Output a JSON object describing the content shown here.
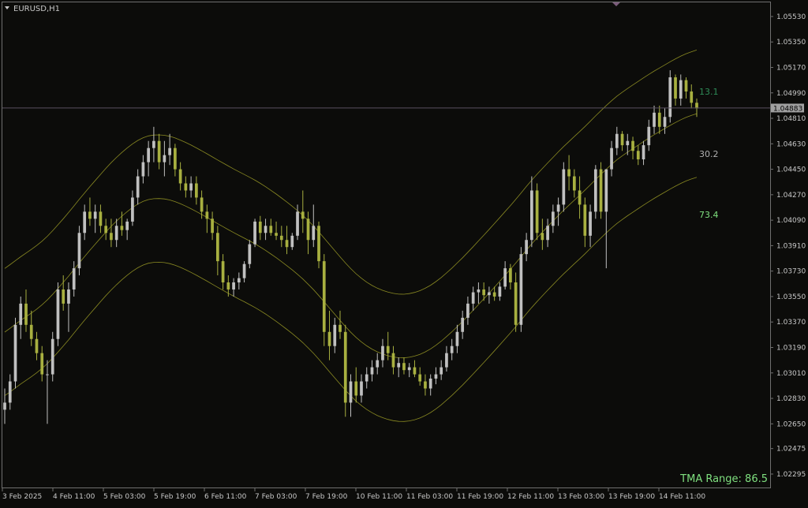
{
  "header": {
    "symbol_label": "EURUSD,H1"
  },
  "colors": {
    "background": "#0c0c0a",
    "axis": "#6f6f6f",
    "text": "#c8c8c8",
    "bull": "#c0c0c0",
    "bear": "#a8b040",
    "band": "#8a8a22",
    "price_line": "#5a5060",
    "price_badge_bg": "#a0a0a0",
    "tma_range_text": "#7fe07f",
    "label_top": "#2e8b57",
    "label_mid": "#b0b0b0",
    "label_bottom": "#7fe07f"
  },
  "chart_data": {
    "type": "candlestick",
    "symbol": "EURUSD",
    "timeframe": "H1",
    "ylim": [
      1.022,
      1.0563
    ],
    "y_ticks": [
      "1.05530",
      "1.05350",
      "1.05170",
      "1.04990",
      "1.04810",
      "1.04630",
      "1.04450",
      "1.04270",
      "1.04090",
      "1.03910",
      "1.03730",
      "1.03550",
      "1.03370",
      "1.03190",
      "1.03010",
      "1.02830",
      "1.02650",
      "1.02475",
      "1.02295"
    ],
    "x_ticks": [
      "3 Feb 2025",
      "4 Feb 11:00",
      "5 Feb 03:00",
      "5 Feb 19:00",
      "6 Feb 11:00",
      "7 Feb 03:00",
      "7 Feb 19:00",
      "10 Feb 11:00",
      "11 Feb 03:00",
      "11 Feb 19:00",
      "12 Feb 11:00",
      "13 Feb 03:00",
      "13 Feb 19:00",
      "14 Feb 11:00"
    ],
    "current_price": "1.04883",
    "series_labels": [
      {
        "text": "13.1",
        "price": 1.05,
        "role": "top"
      },
      {
        "text": "30.2",
        "price": 1.0456,
        "role": "mid"
      },
      {
        "text": "73.4",
        "price": 1.0413,
        "role": "bottom"
      }
    ],
    "tma_range": "TMA Range: 86.5",
    "candles": [
      [
        1.0275,
        1.029,
        1.0265,
        1.028
      ],
      [
        1.028,
        1.03,
        1.0275,
        1.0295
      ],
      [
        1.0295,
        1.034,
        1.029,
        1.0335
      ],
      [
        1.0335,
        1.0355,
        1.0325,
        1.035
      ],
      [
        1.035,
        1.036,
        1.033,
        1.0335
      ],
      [
        1.0335,
        1.0345,
        1.032,
        1.0325
      ],
      [
        1.0325,
        1.033,
        1.031,
        1.0315
      ],
      [
        1.0315,
        1.032,
        1.0295,
        1.03
      ],
      [
        1.03,
        1.031,
        1.0265,
        1.03
      ],
      [
        1.03,
        1.033,
        1.0295,
        1.0325
      ],
      [
        1.0325,
        1.0365,
        1.032,
        1.036
      ],
      [
        1.036,
        1.037,
        1.0345,
        1.035
      ],
      [
        1.035,
        1.0365,
        1.033,
        1.036
      ],
      [
        1.036,
        1.038,
        1.0355,
        1.0375
      ],
      [
        1.0375,
        1.0405,
        1.037,
        1.04
      ],
      [
        1.04,
        1.042,
        1.0395,
        1.0415
      ],
      [
        1.0415,
        1.0425,
        1.0405,
        1.041
      ],
      [
        1.041,
        1.042,
        1.04,
        1.0415
      ],
      [
        1.0415,
        1.042,
        1.04,
        1.0405
      ],
      [
        1.0405,
        1.041,
        1.0395,
        1.04
      ],
      [
        1.04,
        1.041,
        1.039,
        1.0395
      ],
      [
        1.0395,
        1.041,
        1.039,
        1.0405
      ],
      [
        1.0405,
        1.0415,
        1.0398,
        1.0402
      ],
      [
        1.0402,
        1.041,
        1.0395,
        1.0408
      ],
      [
        1.0408,
        1.043,
        1.0405,
        1.0425
      ],
      [
        1.0425,
        1.0445,
        1.042,
        1.044
      ],
      [
        1.044,
        1.0455,
        1.0435,
        1.045
      ],
      [
        1.045,
        1.0465,
        1.044,
        1.046
      ],
      [
        1.046,
        1.0475,
        1.045,
        1.0465
      ],
      [
        1.0465,
        1.047,
        1.0445,
        1.045
      ],
      [
        1.045,
        1.0465,
        1.044,
        1.0455
      ],
      [
        1.0455,
        1.047,
        1.0448,
        1.046
      ],
      [
        1.046,
        1.0463,
        1.044,
        1.0445
      ],
      [
        1.0445,
        1.045,
        1.043,
        1.0435
      ],
      [
        1.0435,
        1.044,
        1.0425,
        1.043
      ],
      [
        1.043,
        1.044,
        1.0425,
        1.0435
      ],
      [
        1.0435,
        1.044,
        1.042,
        1.0425
      ],
      [
        1.0425,
        1.043,
        1.041,
        1.0415
      ],
      [
        1.0415,
        1.042,
        1.04,
        1.041
      ],
      [
        1.041,
        1.0415,
        1.0395,
        1.04
      ],
      [
        1.04,
        1.0405,
        1.037,
        1.038
      ],
      [
        1.038,
        1.0385,
        1.036,
        1.0365
      ],
      [
        1.0365,
        1.037,
        1.0355,
        1.036
      ],
      [
        1.036,
        1.0368,
        1.0355,
        1.0365
      ],
      [
        1.0365,
        1.0372,
        1.036,
        1.0368
      ],
      [
        1.0368,
        1.038,
        1.0365,
        1.0378
      ],
      [
        1.0378,
        1.0395,
        1.0375,
        1.0392
      ],
      [
        1.0392,
        1.041,
        1.039,
        1.0408
      ],
      [
        1.0408,
        1.0412,
        1.0395,
        1.04
      ],
      [
        1.04,
        1.041,
        1.0395,
        1.0405
      ],
      [
        1.0405,
        1.041,
        1.0398,
        1.04
      ],
      [
        1.04,
        1.0408,
        1.0395,
        1.0398
      ],
      [
        1.0398,
        1.0405,
        1.039,
        1.0395
      ],
      [
        1.0395,
        1.0405,
        1.0385,
        1.039
      ],
      [
        1.039,
        1.04,
        1.0388,
        1.0398
      ],
      [
        1.0398,
        1.042,
        1.0395,
        1.0415
      ],
      [
        1.0415,
        1.043,
        1.04,
        1.041
      ],
      [
        1.041,
        1.0415,
        1.0385,
        1.0395
      ],
      [
        1.0395,
        1.042,
        1.039,
        1.0405
      ],
      [
        1.0405,
        1.0408,
        1.0375,
        1.038
      ],
      [
        1.038,
        1.0385,
        1.032,
        1.033
      ],
      [
        1.033,
        1.0345,
        1.031,
        1.032
      ],
      [
        1.032,
        1.034,
        1.0315,
        1.0335
      ],
      [
        1.0335,
        1.0345,
        1.0325,
        1.033
      ],
      [
        1.033,
        1.0335,
        1.027,
        1.028
      ],
      [
        1.028,
        1.03,
        1.027,
        1.0295
      ],
      [
        1.0295,
        1.0305,
        1.028,
        1.0285
      ],
      [
        1.0285,
        1.03,
        1.028,
        1.0295
      ],
      [
        1.0295,
        1.0305,
        1.029,
        1.03
      ],
      [
        1.03,
        1.031,
        1.0295,
        1.0305
      ],
      [
        1.0305,
        1.0315,
        1.03,
        1.031
      ],
      [
        1.031,
        1.0325,
        1.0305,
        1.032
      ],
      [
        1.032,
        1.033,
        1.031,
        1.0315
      ],
      [
        1.0315,
        1.032,
        1.03,
        1.0305
      ],
      [
        1.0305,
        1.0312,
        1.0298,
        1.0308
      ],
      [
        1.0308,
        1.0312,
        1.03,
        1.0303
      ],
      [
        1.0303,
        1.0308,
        1.0298,
        1.0305
      ],
      [
        1.0305,
        1.031,
        1.0298,
        1.03
      ],
      [
        1.03,
        1.0305,
        1.0292,
        1.0295
      ],
      [
        1.0295,
        1.03,
        1.0285,
        1.029
      ],
      [
        1.029,
        1.03,
        1.0285,
        1.0297
      ],
      [
        1.0297,
        1.0305,
        1.0293,
        1.03
      ],
      [
        1.03,
        1.031,
        1.0296,
        1.0305
      ],
      [
        1.0305,
        1.032,
        1.0302,
        1.0315
      ],
      [
        1.0315,
        1.0325,
        1.031,
        1.032
      ],
      [
        1.032,
        1.0335,
        1.0315,
        1.033
      ],
      [
        1.033,
        1.0345,
        1.0325,
        1.034
      ],
      [
        1.034,
        1.0355,
        1.0335,
        1.035
      ],
      [
        1.035,
        1.0362,
        1.0345,
        1.0358
      ],
      [
        1.0358,
        1.0365,
        1.035,
        1.036
      ],
      [
        1.036,
        1.0365,
        1.0352,
        1.0356
      ],
      [
        1.0356,
        1.0362,
        1.035,
        1.0358
      ],
      [
        1.0358,
        1.0362,
        1.0352,
        1.0355
      ],
      [
        1.0355,
        1.0365,
        1.0352,
        1.0362
      ],
      [
        1.0362,
        1.038,
        1.036,
        1.0375
      ],
      [
        1.0375,
        1.0378,
        1.036,
        1.0365
      ],
      [
        1.0365,
        1.0372,
        1.033,
        1.0335
      ],
      [
        1.0335,
        1.039,
        1.033,
        1.0385
      ],
      [
        1.0385,
        1.04,
        1.038,
        1.0395
      ],
      [
        1.0395,
        1.044,
        1.039,
        1.043
      ],
      [
        1.043,
        1.0435,
        1.0395,
        1.04
      ],
      [
        1.04,
        1.041,
        1.0388,
        1.0395
      ],
      [
        1.0395,
        1.041,
        1.039,
        1.0405
      ],
      [
        1.0405,
        1.042,
        1.04,
        1.0415
      ],
      [
        1.0415,
        1.0425,
        1.0405,
        1.042
      ],
      [
        1.042,
        1.045,
        1.0415,
        1.0445
      ],
      [
        1.0445,
        1.0455,
        1.043,
        1.044
      ],
      [
        1.044,
        1.0445,
        1.0425,
        1.043
      ],
      [
        1.043,
        1.044,
        1.041,
        1.042
      ],
      [
        1.042,
        1.0425,
        1.039,
        1.0398
      ],
      [
        1.0398,
        1.042,
        1.039,
        1.0415
      ],
      [
        1.0415,
        1.0448,
        1.041,
        1.0445
      ],
      [
        1.0445,
        1.045,
        1.041,
        1.0415
      ],
      [
        1.0415,
        1.042,
        1.0375,
        1.0445
      ],
      [
        1.0445,
        1.0465,
        1.044,
        1.046
      ],
      [
        1.046,
        1.0475,
        1.0455,
        1.047
      ],
      [
        1.047,
        1.0472,
        1.0458,
        1.0462
      ],
      [
        1.0462,
        1.047,
        1.0455,
        1.0465
      ],
      [
        1.0465,
        1.0468,
        1.0452,
        1.0458
      ],
      [
        1.0458,
        1.0462,
        1.0448,
        1.0452
      ],
      [
        1.0452,
        1.0465,
        1.0448,
        1.0462
      ],
      [
        1.0462,
        1.048,
        1.0458,
        1.0475
      ],
      [
        1.0475,
        1.049,
        1.047,
        1.0485
      ],
      [
        1.0485,
        1.049,
        1.047,
        1.0475
      ],
      [
        1.0475,
        1.0488,
        1.047,
        1.0482
      ],
      [
        1.0482,
        1.0515,
        1.0478,
        1.051
      ],
      [
        1.051,
        1.0512,
        1.049,
        1.0495
      ],
      [
        1.0495,
        1.0512,
        1.049,
        1.0508
      ],
      [
        1.0508,
        1.051,
        1.0495,
        1.05
      ],
      [
        1.05,
        1.0505,
        1.0488,
        1.0492
      ],
      [
        1.0492,
        1.0495,
        1.0482,
        1.0488
      ]
    ]
  }
}
